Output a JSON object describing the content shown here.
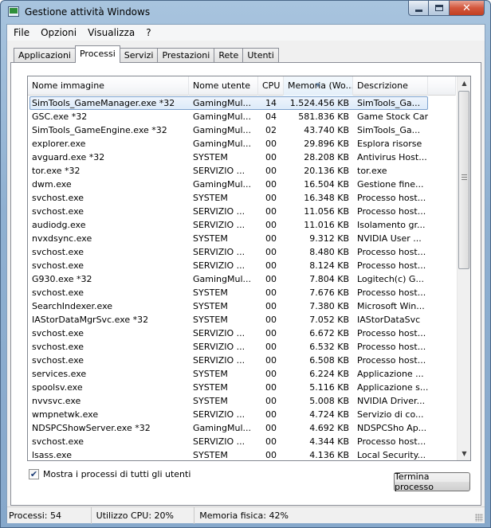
{
  "window": {
    "title": "Gestione attività Windows"
  },
  "menu": [
    "File",
    "Opzioni",
    "Visualizza",
    "?"
  ],
  "tabs": [
    {
      "label": "Applicazioni",
      "active": false
    },
    {
      "label": "Processi",
      "active": true
    },
    {
      "label": "Servizi",
      "active": false
    },
    {
      "label": "Prestazioni",
      "active": false
    },
    {
      "label": "Rete",
      "active": false
    },
    {
      "label": "Utenti",
      "active": false
    }
  ],
  "columns": {
    "name": "Nome immagine",
    "user": "Nome utente",
    "cpu": "CPU",
    "memory": "Memoria (Wo...",
    "description": "Descrizione"
  },
  "sorted_column": "memory",
  "processes": [
    {
      "name": "SimTools_GameManager.exe *32",
      "user": "GamingMul...",
      "cpu": "14",
      "memory": "1.524.456 KB",
      "desc": "SimTools_Ga...",
      "selected": true
    },
    {
      "name": "GSC.exe *32",
      "user": "GamingMul...",
      "cpu": "04",
      "memory": "581.836 KB",
      "desc": "Game Stock Car"
    },
    {
      "name": "SimTools_GameEngine.exe *32",
      "user": "GamingMul...",
      "cpu": "02",
      "memory": "43.740 KB",
      "desc": "SimTools_Ga..."
    },
    {
      "name": "explorer.exe",
      "user": "GamingMul...",
      "cpu": "00",
      "memory": "29.896 KB",
      "desc": "Esplora risorse"
    },
    {
      "name": "avguard.exe *32",
      "user": "SYSTEM",
      "cpu": "00",
      "memory": "28.208 KB",
      "desc": "Antivirus Host..."
    },
    {
      "name": "tor.exe *32",
      "user": "SERVIZIO ...",
      "cpu": "00",
      "memory": "20.136 KB",
      "desc": "tor.exe"
    },
    {
      "name": "dwm.exe",
      "user": "GamingMul...",
      "cpu": "00",
      "memory": "16.504 KB",
      "desc": "Gestione fine..."
    },
    {
      "name": "svchost.exe",
      "user": "SYSTEM",
      "cpu": "00",
      "memory": "16.348 KB",
      "desc": "Processo host..."
    },
    {
      "name": "svchost.exe",
      "user": "SERVIZIO ...",
      "cpu": "00",
      "memory": "11.056 KB",
      "desc": "Processo host..."
    },
    {
      "name": "audiodg.exe",
      "user": "SERVIZIO ...",
      "cpu": "00",
      "memory": "11.016 KB",
      "desc": "Isolamento gr..."
    },
    {
      "name": "nvxdsync.exe",
      "user": "SYSTEM",
      "cpu": "00",
      "memory": "9.312 KB",
      "desc": "NVIDIA User ..."
    },
    {
      "name": "svchost.exe",
      "user": "SERVIZIO ...",
      "cpu": "00",
      "memory": "8.480 KB",
      "desc": "Processo host..."
    },
    {
      "name": "svchost.exe",
      "user": "SERVIZIO ...",
      "cpu": "00",
      "memory": "8.124 KB",
      "desc": "Processo host..."
    },
    {
      "name": "G930.exe *32",
      "user": "GamingMul...",
      "cpu": "00",
      "memory": "7.804 KB",
      "desc": "Logitech(c) G..."
    },
    {
      "name": "svchost.exe",
      "user": "SYSTEM",
      "cpu": "00",
      "memory": "7.676 KB",
      "desc": "Processo host..."
    },
    {
      "name": "SearchIndexer.exe",
      "user": "SYSTEM",
      "cpu": "00",
      "memory": "7.380 KB",
      "desc": "Microsoft Win..."
    },
    {
      "name": "IAStorDataMgrSvc.exe *32",
      "user": "SYSTEM",
      "cpu": "00",
      "memory": "7.052 KB",
      "desc": "IAStorDataSvc"
    },
    {
      "name": "svchost.exe",
      "user": "SERVIZIO ...",
      "cpu": "00",
      "memory": "6.672 KB",
      "desc": "Processo host..."
    },
    {
      "name": "svchost.exe",
      "user": "SERVIZIO ...",
      "cpu": "00",
      "memory": "6.532 KB",
      "desc": "Processo host..."
    },
    {
      "name": "svchost.exe",
      "user": "SERVIZIO ...",
      "cpu": "00",
      "memory": "6.508 KB",
      "desc": "Processo host..."
    },
    {
      "name": "services.exe",
      "user": "SYSTEM",
      "cpu": "00",
      "memory": "6.224 KB",
      "desc": "Applicazione ..."
    },
    {
      "name": "spoolsv.exe",
      "user": "SYSTEM",
      "cpu": "00",
      "memory": "5.116 KB",
      "desc": "Applicazione s..."
    },
    {
      "name": "nvvsvc.exe",
      "user": "SYSTEM",
      "cpu": "00",
      "memory": "5.008 KB",
      "desc": "NVIDIA Driver..."
    },
    {
      "name": "wmpnetwk.exe",
      "user": "SERVIZIO ...",
      "cpu": "00",
      "memory": "4.724 KB",
      "desc": "Servizio di co..."
    },
    {
      "name": "NDSPCShowServer.exe *32",
      "user": "GamingMul...",
      "cpu": "00",
      "memory": "4.692 KB",
      "desc": "NDSPCSho Ap..."
    },
    {
      "name": "svchost.exe",
      "user": "SERVIZIO ...",
      "cpu": "00",
      "memory": "4.344 KB",
      "desc": "Processo host..."
    },
    {
      "name": "lsass.exe",
      "user": "SYSTEM",
      "cpu": "00",
      "memory": "4.136 KB",
      "desc": "Local Security..."
    }
  ],
  "show_all_users": {
    "label": "Mostra i processi di tutti gli utenti",
    "checked": true
  },
  "end_process_label": "Termina processo",
  "status": {
    "processes": "Processi: 54",
    "cpu": "Utilizzo CPU: 20%",
    "memory": "Memoria fisica: 42%"
  }
}
